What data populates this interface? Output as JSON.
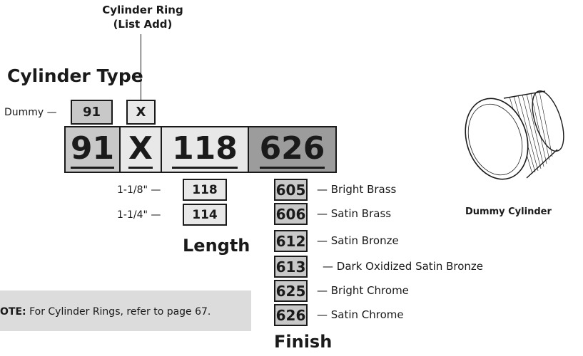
{
  "header": {
    "ring_label_line1": "Cylinder Ring",
    "ring_label_line2": "(List Add)",
    "cylinder_type_title": "Cylinder Type"
  },
  "type_options": {
    "dummy_label": "Dummy —",
    "dummy_code": "91",
    "ring_code": "X"
  },
  "model": {
    "segments": [
      "91",
      "X",
      "118",
      "626"
    ]
  },
  "length": {
    "title": "Length",
    "options": [
      {
        "label": "1-1/8\" —",
        "code": "118"
      },
      {
        "label": "1-1/4\" —",
        "code": "114"
      }
    ]
  },
  "finish": {
    "title": "Finish",
    "options": [
      {
        "code": "605",
        "label": "— Bright Brass"
      },
      {
        "code": "606",
        "label": "— Satin Brass"
      },
      {
        "code": "612",
        "label": "— Satin Bronze"
      },
      {
        "code": "613",
        "label": "— Dark Oxidized Satin Bronze"
      },
      {
        "code": "625",
        "label": "— Bright Chrome"
      },
      {
        "code": "626",
        "label": "— Satin Chrome"
      }
    ]
  },
  "note": {
    "prefix": "OTE:",
    "text": " For Cylinder Rings, refer to page 67."
  },
  "illustration": {
    "caption": "Dummy Cylinder"
  }
}
